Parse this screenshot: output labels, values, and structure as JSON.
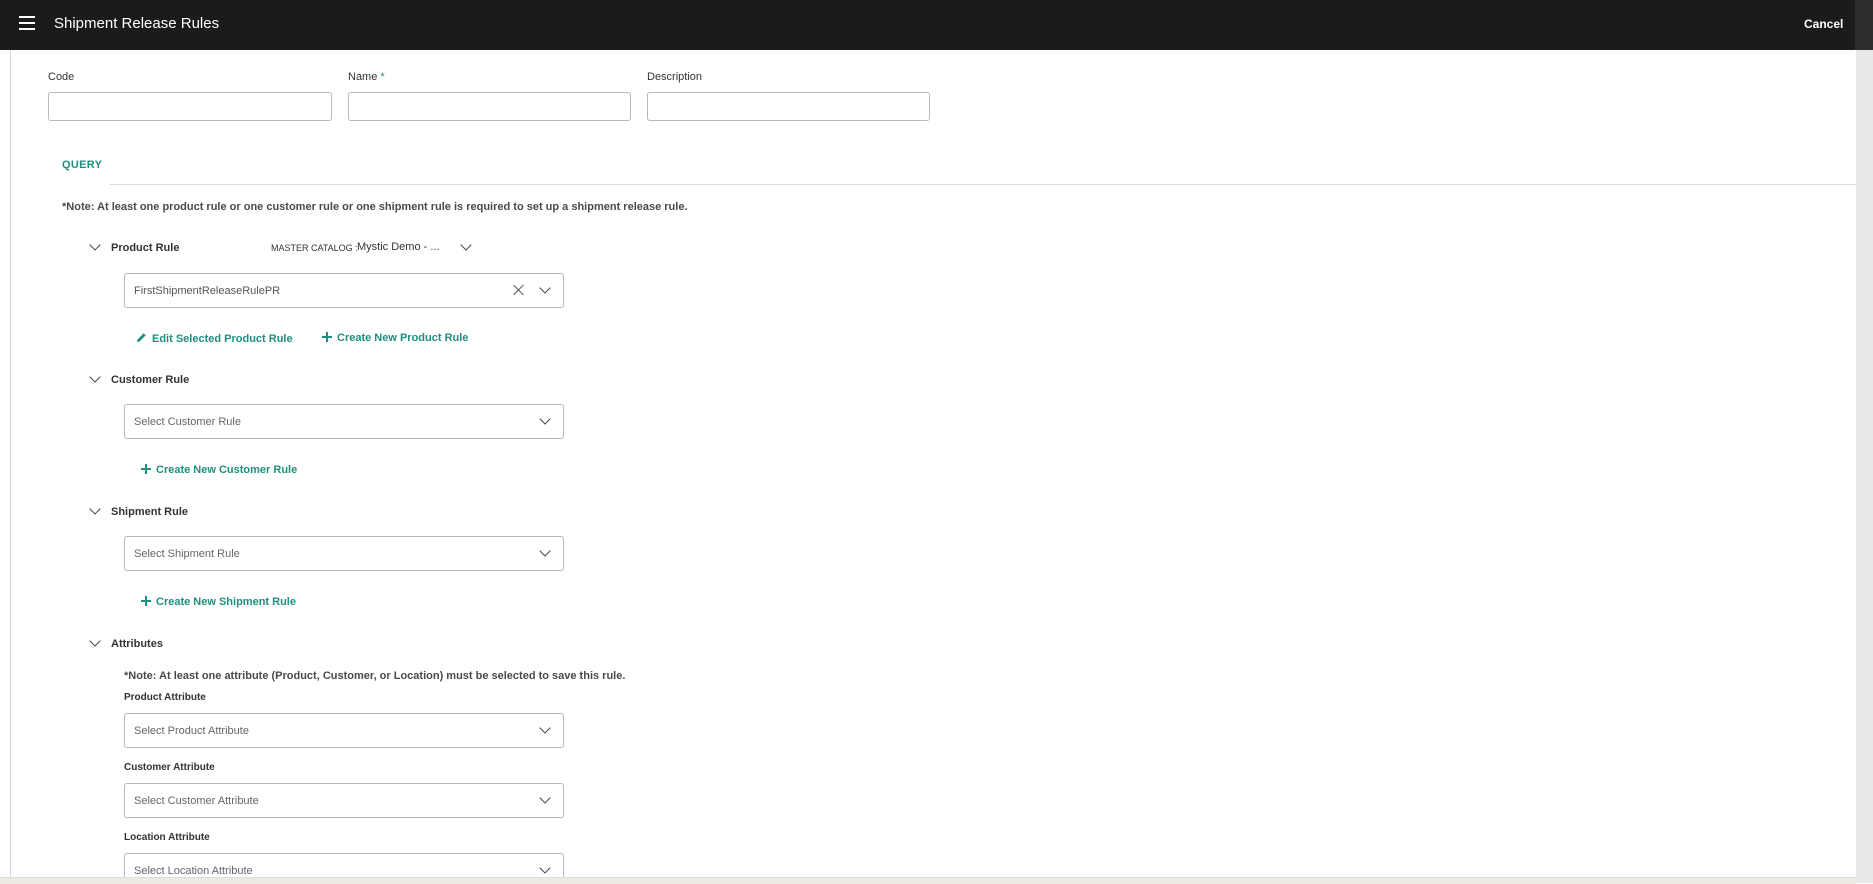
{
  "header": {
    "title": "Shipment Release Rules",
    "cancel_label": "Cancel",
    "menu_icon": "hamburger-menu-icon"
  },
  "form": {
    "code_label": "Code",
    "name_label": "Name",
    "name_required_mark": "*",
    "description_label": "Description",
    "code_value": "",
    "name_value": "",
    "description_value": ""
  },
  "query": {
    "tab_label": "QUERY",
    "note": "*Note: At least one product rule or one customer rule or one shipment rule is required to set up a shipment release rule.",
    "product_rule": {
      "title": "Product Rule",
      "catalog_label": "MASTER CATALOG :",
      "catalog_value": "Mystic Demo - ...",
      "selected": "FirstShipmentReleaseRulePR",
      "edit_label": "Edit Selected Product Rule",
      "create_label": "Create New Product Rule"
    },
    "customer_rule": {
      "title": "Customer Rule",
      "placeholder": "Select Customer Rule",
      "create_label": "Create New Customer Rule"
    },
    "shipment_rule": {
      "title": "Shipment Rule",
      "placeholder": "Select Shipment Rule",
      "create_label": "Create New Shipment Rule"
    },
    "attributes": {
      "title": "Attributes",
      "note": "*Note: At least one attribute (Product, Customer, or Location) must be selected to save this rule.",
      "product_label": "Product Attribute",
      "product_placeholder": "Select Product Attribute",
      "customer_label": "Customer Attribute",
      "customer_placeholder": "Select Customer Attribute",
      "location_label": "Location Attribute",
      "location_placeholder": "Select Location Attribute"
    }
  },
  "colors": {
    "header_bg": "#1b1b1b",
    "accent": "#1f8f7f"
  }
}
